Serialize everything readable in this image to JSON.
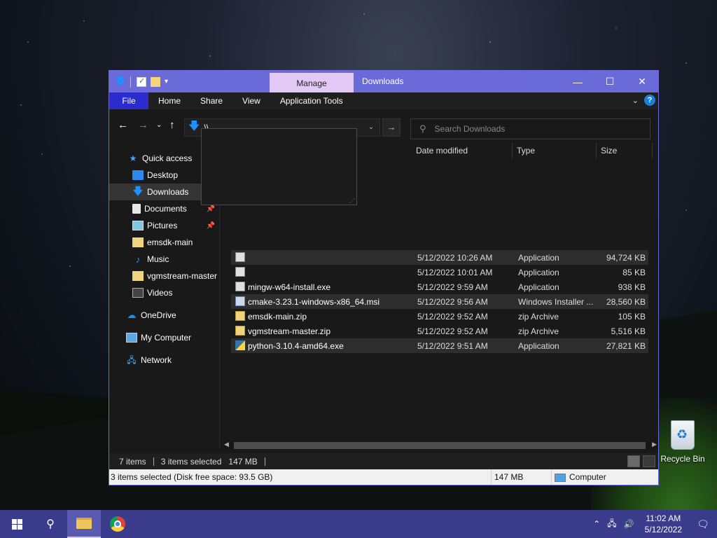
{
  "window": {
    "ribbon_context_tab": "Manage",
    "title": "Downloads",
    "ribbon_tabs": [
      "File",
      "Home",
      "Share",
      "View",
      "Application Tools"
    ],
    "minimize_icon": "minimize-icon",
    "maximize_icon": "maximize-icon",
    "close_icon": "close-icon"
  },
  "address": {
    "value": "\\\\",
    "search_placeholder": "Search Downloads"
  },
  "sidebar": {
    "items": [
      {
        "label": "Quick access",
        "icon": "star-icon",
        "indent": 0
      },
      {
        "label": "Desktop",
        "icon": "desktop-icon",
        "indent": 1
      },
      {
        "label": "Downloads",
        "icon": "download-arrow-icon",
        "indent": 1
      },
      {
        "label": "Documents",
        "icon": "documents-icon",
        "indent": 1
      },
      {
        "label": "Pictures",
        "icon": "pictures-icon",
        "indent": 1
      },
      {
        "label": "emsdk-main",
        "icon": "folder-icon",
        "indent": 1
      },
      {
        "label": "Music",
        "icon": "music-icon",
        "indent": 1
      },
      {
        "label": "vgmstream-master",
        "icon": "folder-icon",
        "indent": 1
      },
      {
        "label": "Videos",
        "icon": "videos-icon",
        "indent": 1
      },
      {
        "label": "OneDrive",
        "icon": "cloud-icon",
        "indent": 0
      },
      {
        "label": "My Computer",
        "icon": "computer-icon",
        "indent": 0
      },
      {
        "label": "Network",
        "icon": "network-icon",
        "indent": 0
      }
    ]
  },
  "columns": {
    "date": "Date modified",
    "type": "Type",
    "size": "Size"
  },
  "files": [
    {
      "name": "",
      "date": "5/12/2022 10:26 AM",
      "type": "Application",
      "size": "94,724 KB",
      "icon": "exe-icon",
      "selected": true
    },
    {
      "name": "",
      "date": "5/12/2022 10:01 AM",
      "type": "Application",
      "size": "85 KB",
      "icon": "exe-icon",
      "selected": false
    },
    {
      "name": "mingw-w64-install.exe",
      "date": "5/12/2022 9:59 AM",
      "type": "Application",
      "size": "938 KB",
      "icon": "installer-icon",
      "selected": false
    },
    {
      "name": "cmake-3.23.1-windows-x86_64.msi",
      "date": "5/12/2022 9:56 AM",
      "type": "Windows Installer ...",
      "size": "28,560 KB",
      "icon": "msi-icon",
      "selected": true
    },
    {
      "name": "emsdk-main.zip",
      "date": "5/12/2022 9:52 AM",
      "type": "zip Archive",
      "size": "105 KB",
      "icon": "zip-icon",
      "selected": false
    },
    {
      "name": "vgmstream-master.zip",
      "date": "5/12/2022 9:52 AM",
      "type": "zip Archive",
      "size": "5,516 KB",
      "icon": "zip-icon",
      "selected": false
    },
    {
      "name": "python-3.10.4-amd64.exe",
      "date": "5/12/2022 9:51 AM",
      "type": "Application",
      "size": "27,821 KB",
      "icon": "python-icon",
      "selected": true
    }
  ],
  "status": {
    "items": "7 items",
    "selected": "3 items selected",
    "selected_size": "147 MB"
  },
  "details": {
    "summary": "3 items selected (Disk free space: 93.5 GB)",
    "size": "147 MB",
    "location": "Computer"
  },
  "desktop": {
    "recycle_bin": "Recycle Bin"
  },
  "taskbar": {
    "time": "11:02 AM",
    "date": "5/12/2022"
  },
  "colors": {
    "titlebar": "#6a6ad8",
    "manage_tab": "#e4c8f5",
    "file_tab": "#2b2bd0",
    "taskbar": "#3b3b8c"
  }
}
